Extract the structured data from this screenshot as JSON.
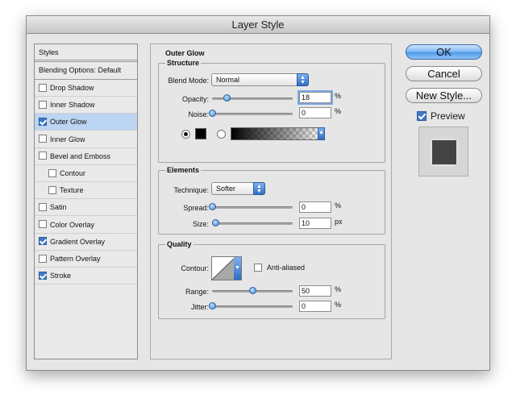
{
  "window": {
    "title": "Layer Style"
  },
  "styles_list": {
    "header": "Styles",
    "blending_options": "Blending Options: Default",
    "items": [
      {
        "label": "Drop Shadow",
        "checked": false,
        "selected": false
      },
      {
        "label": "Inner Shadow",
        "checked": false,
        "selected": false
      },
      {
        "label": "Outer Glow",
        "checked": true,
        "selected": true
      },
      {
        "label": "Inner Glow",
        "checked": false,
        "selected": false
      },
      {
        "label": "Bevel and Emboss",
        "checked": false,
        "selected": false
      },
      {
        "label": "Contour",
        "checked": false,
        "selected": false
      },
      {
        "label": "Texture",
        "checked": false,
        "selected": false
      },
      {
        "label": "Satin",
        "checked": false,
        "selected": false
      },
      {
        "label": "Color Overlay",
        "checked": false,
        "selected": false
      },
      {
        "label": "Gradient Overlay",
        "checked": true,
        "selected": false
      },
      {
        "label": "Pattern Overlay",
        "checked": false,
        "selected": false
      },
      {
        "label": "Stroke",
        "checked": true,
        "selected": false
      }
    ]
  },
  "outer_glow": {
    "title": "Outer Glow",
    "structure": {
      "title": "Structure",
      "blend_mode_label": "Blend Mode:",
      "blend_mode_value": "Normal",
      "opacity_label": "Opacity:",
      "opacity_value": "18",
      "opacity_fraction": 0.18,
      "opacity_unit": "%",
      "noise_label": "Noise:",
      "noise_value": "0",
      "noise_fraction": 0.0,
      "noise_unit": "%",
      "color_swatch": "#000000"
    },
    "elements": {
      "title": "Elements",
      "technique_label": "Technique:",
      "technique_value": "Softer",
      "spread_label": "Spread:",
      "spread_value": "0",
      "spread_fraction": 0.0,
      "spread_unit": "%",
      "size_label": "Size:",
      "size_value": "10",
      "size_fraction": 0.04,
      "size_unit": "px"
    },
    "quality": {
      "title": "Quality",
      "contour_label": "Contour:",
      "anti_aliased_label": "Anti-aliased",
      "anti_aliased_checked": false,
      "range_label": "Range:",
      "range_value": "50",
      "range_fraction": 0.5,
      "range_unit": "%",
      "jitter_label": "Jitter:",
      "jitter_value": "0",
      "jitter_fraction": 0.0,
      "jitter_unit": "%"
    }
  },
  "buttons": {
    "ok": "OK",
    "cancel": "Cancel",
    "new_style": "New Style...",
    "preview_label": "Preview",
    "preview_checked": true
  },
  "colors": {
    "accent": "#3d78c6",
    "selection": "#bcd5f3"
  }
}
